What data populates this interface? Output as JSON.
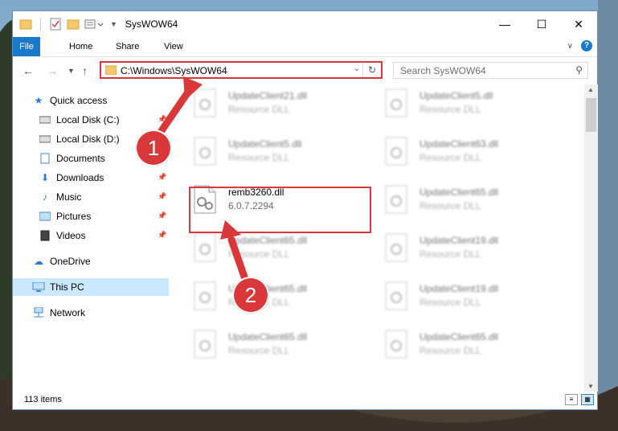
{
  "window": {
    "title": "SysWOW64",
    "ribbon_tabs": [
      "File",
      "Home",
      "Share",
      "View"
    ]
  },
  "address_bar": {
    "path": "C:\\Windows\\SysWOW64"
  },
  "search": {
    "placeholder": "Search SysWOW64"
  },
  "sidebar": {
    "items": [
      {
        "label": "Quick access",
        "icon": "star-icon"
      },
      {
        "label": "Local Disk (C:)",
        "icon": "drive-icon",
        "pinned": true
      },
      {
        "label": "Local Disk (D:)",
        "icon": "drive-icon"
      },
      {
        "label": "Documents",
        "icon": "documents-icon",
        "pinned": true
      },
      {
        "label": "Downloads",
        "icon": "download-icon",
        "pinned": true
      },
      {
        "label": "Music",
        "icon": "music-icon",
        "pinned": true
      },
      {
        "label": "Pictures",
        "icon": "pictures-icon",
        "pinned": true
      },
      {
        "label": "Videos",
        "icon": "videos-icon",
        "pinned": true
      },
      {
        "label": "OneDrive",
        "icon": "cloud-icon"
      },
      {
        "label": "This PC",
        "icon": "computer-icon",
        "selected": true
      },
      {
        "label": "Network",
        "icon": "network-icon"
      }
    ]
  },
  "files": {
    "left_column": [
      {
        "name": "UpdateClient21.dll",
        "desc": "Resource DLL"
      },
      {
        "name": "UpdateClient5.dll",
        "desc": "Resource DLL"
      },
      {
        "name": "remb3260.dll",
        "desc": "6.0.7.2294"
      },
      {
        "name": "UpdateClient65.dll",
        "desc": "Resource DLL"
      },
      {
        "name": "UpdateClient65.dll",
        "desc": "Resource DLL"
      },
      {
        "name": "UpdateClient65.dll",
        "desc": "Resource DLL"
      }
    ],
    "right_column": [
      {
        "name": "UpdateClient5.dll",
        "desc": "Resource DLL"
      },
      {
        "name": "UpdateClient63.dll",
        "desc": "Resource DLL"
      },
      {
        "name": "UpdateClient65.dll",
        "desc": "Resource DLL"
      },
      {
        "name": "UpdateClient19.dll",
        "desc": "Resource DLL"
      },
      {
        "name": "UpdateClient19.dll",
        "desc": "Resource DLL"
      },
      {
        "name": "UpdateClient65.dll",
        "desc": "Resource DLL"
      }
    ]
  },
  "status": {
    "item_count": "113 items"
  },
  "annotations": {
    "step1": "1",
    "step2": "2",
    "color": "#d9383b"
  }
}
